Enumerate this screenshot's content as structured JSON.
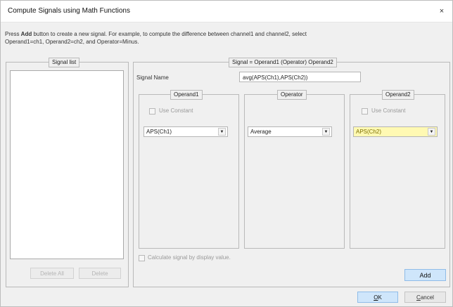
{
  "window": {
    "title": "Compute Signals using Math Functions",
    "close_glyph": "×"
  },
  "instructions": {
    "prefix": "Press ",
    "bold": "Add",
    "line1_rest": " button to create a new signal. For example, to compute the difference between channel1 and channel2, select",
    "line2": "Operand1=ch1, Operand2=ch2, and Operator=Minus."
  },
  "signal_list": {
    "caption": "Signal list",
    "delete_all_label": "Delete All",
    "delete_label": "Delete"
  },
  "signal_group": {
    "caption": "Signal = Operand1 (Operator) Operand2",
    "name_label": "Signal Name",
    "name_value": "avg(APS(Ch1),APS(Ch2))",
    "operand1": {
      "caption": "Operand1",
      "use_constant_label": "Use Constant",
      "use_constant_checked": false,
      "selected": "APS(Ch1)"
    },
    "operator": {
      "caption": "Operator",
      "selected": "Average"
    },
    "operand2": {
      "caption": "Operand2",
      "use_constant_label": "Use Constant",
      "use_constant_checked": false,
      "selected": "APS(Ch2)"
    },
    "display_value_label": "Calculate signal by display value.",
    "display_value_checked": false,
    "add_label": "Add"
  },
  "footer": {
    "ok_label": "OK",
    "ok_mnemonic": "O",
    "cancel_label": "Cancel",
    "cancel_mnemonic": "C"
  },
  "colors": {
    "highlight": "#fff9b3",
    "primary_button": "#cfe6fb"
  }
}
